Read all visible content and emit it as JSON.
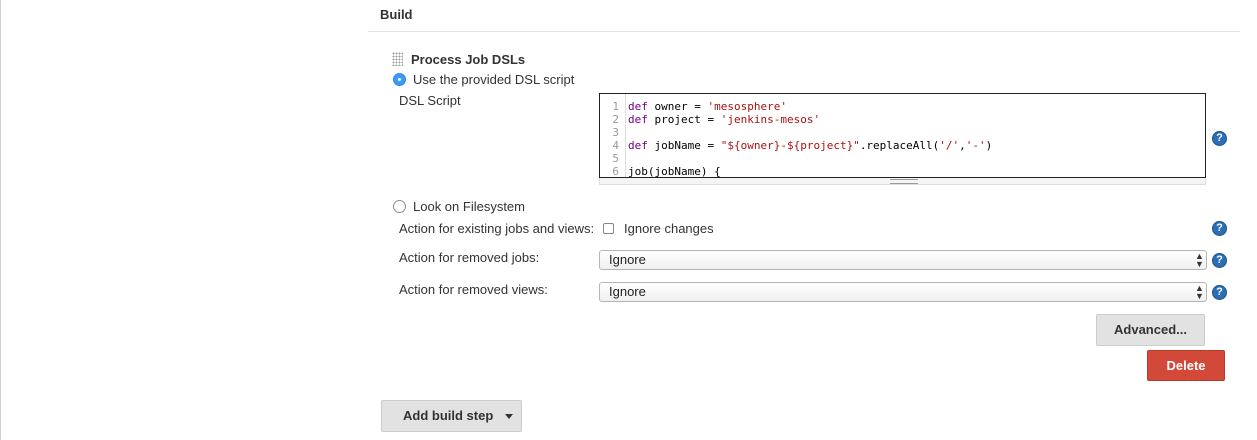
{
  "section": {
    "title": "Build"
  },
  "step": {
    "title": "Process Job DSLs",
    "radio_use_script": "Use the provided DSL script",
    "dsl_script_label": "DSL Script",
    "code_lines": [
      {
        "num": "1",
        "parts": [
          {
            "t": "kw",
            "v": "def"
          },
          {
            "t": "plain",
            "v": " owner = "
          },
          {
            "t": "str",
            "v": "'mesosphere'"
          }
        ]
      },
      {
        "num": "2",
        "parts": [
          {
            "t": "kw",
            "v": "def"
          },
          {
            "t": "plain",
            "v": " project = "
          },
          {
            "t": "str",
            "v": "'jenkins-mesos'"
          }
        ]
      },
      {
        "num": "3",
        "parts": []
      },
      {
        "num": "4",
        "parts": [
          {
            "t": "kw",
            "v": "def"
          },
          {
            "t": "plain",
            "v": " jobName = "
          },
          {
            "t": "str",
            "v": "\"${owner}-${project}\""
          },
          {
            "t": "plain",
            "v": ".replaceAll("
          },
          {
            "t": "str",
            "v": "'/'"
          },
          {
            "t": "plain",
            "v": ","
          },
          {
            "t": "str",
            "v": "'-'"
          },
          {
            "t": "plain",
            "v": ")"
          }
        ]
      },
      {
        "num": "5",
        "parts": []
      },
      {
        "num": "6",
        "parts": [
          {
            "t": "plain",
            "v": "job(jobName) {"
          }
        ]
      }
    ],
    "radio_filesystem": "Look on Filesystem",
    "existing_label": "Action for existing jobs and views:",
    "ignore_changes_label": "Ignore changes",
    "removed_jobs_label": "Action for removed jobs:",
    "removed_jobs_value": "Ignore",
    "removed_views_label": "Action for removed views:",
    "removed_views_value": "Ignore",
    "advanced_label": "Advanced...",
    "delete_label": "Delete",
    "help_glyph": "?"
  },
  "add_build_step_label": "Add build step",
  "icons": {
    "handle": "drag-handle-icon",
    "help": "help-icon",
    "select_arrows": "up-down-arrows-icon",
    "dropdown": "caret-down-icon"
  },
  "colors": {
    "delete": "#d24939",
    "radio_selected": "#3b99fc",
    "help": "#2c6fb4",
    "keyword": "#770088",
    "string": "#aa1111"
  }
}
